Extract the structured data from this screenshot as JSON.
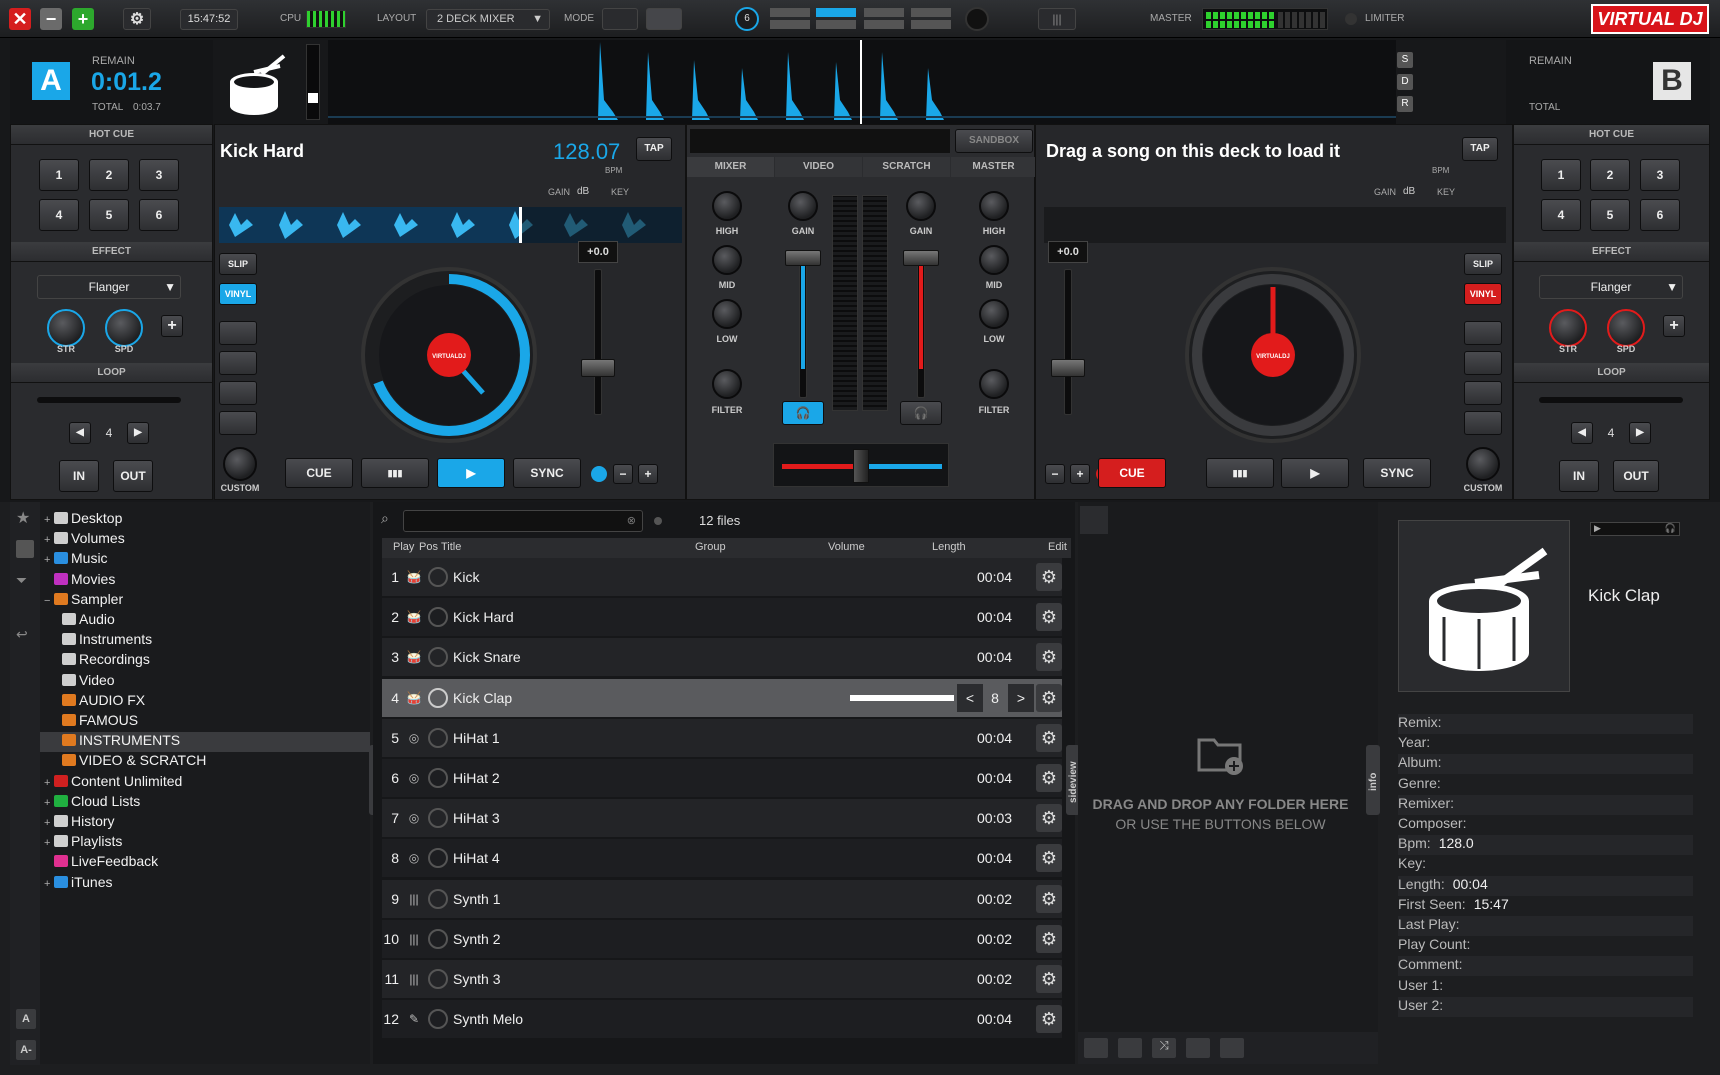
{
  "topbar": {
    "time": "15:47:52",
    "cpu_label": "CPU",
    "layout_label": "LAYOUT",
    "layout_value": "2 DECK MIXER",
    "mode_label": "MODE",
    "decks_count": "6",
    "master_label": "MASTER",
    "limiter_label": "LIMITER",
    "logo": "VIRTUAL DJ",
    "colors": {
      "close": "#e02020",
      "minimize": "#666666",
      "maximize": "#2fb52f",
      "accent": "#1aa7e8",
      "logo": "#d8141a"
    }
  },
  "deck_a": {
    "letter": "A",
    "remain_label": "REMAIN",
    "remain": "0:01.2",
    "total_label": "TOTAL",
    "total": "0:03.7",
    "title": "Kick Hard",
    "bpm": "128.07",
    "bpm_label": "BPM",
    "tap": "TAP",
    "gain_label": "GAIN",
    "db_label": "dB",
    "key_label": "KEY",
    "pitch": "+0.0",
    "slip": "SLIP",
    "vinyl": "VINYL",
    "custom": "CUSTOM",
    "cue": "CUE",
    "pause": "▮▮▮",
    "play": "▶",
    "sync": "SYNC",
    "minus": "−",
    "plus": "+"
  },
  "deck_b": {
    "letter": "B",
    "remain_label": "REMAIN",
    "total_label": "TOTAL",
    "title": "Drag a song on this deck to load it",
    "bpm_label": "BPM",
    "tap": "TAP",
    "gain_label": "GAIN",
    "db_label": "dB",
    "key_label": "KEY",
    "pitch": "+0.0",
    "slip": "SLIP",
    "vinyl": "VINYL",
    "custom": "CUSTOM",
    "cue": "CUE",
    "pause": "▮▮▮",
    "play": "▶",
    "sync": "SYNC",
    "minus": "−",
    "plus": "+"
  },
  "left_side": {
    "hotcue_label": "HOT CUE",
    "hotcues": [
      "1",
      "2",
      "3",
      "4",
      "5",
      "6"
    ],
    "effect_label": "EFFECT",
    "effect_value": "Flanger",
    "str": "STR",
    "spd": "SPD",
    "add": "+",
    "loop_label": "LOOP",
    "loop_value": "4",
    "loop_prev": "◀",
    "loop_next": "▶",
    "in": "IN",
    "out": "OUT"
  },
  "right_side": {
    "hotcue_label": "HOT CUE",
    "hotcues": [
      "1",
      "2",
      "3",
      "4",
      "5",
      "6"
    ],
    "effect_label": "EFFECT",
    "effect_value": "Flanger",
    "str": "STR",
    "spd": "SPD",
    "add": "+",
    "loop_label": "LOOP",
    "loop_value": "4",
    "loop_prev": "◀",
    "loop_next": "▶",
    "in": "IN",
    "out": "OUT"
  },
  "mixer": {
    "sandbox": "SANDBOX",
    "tabs": [
      "MIXER",
      "VIDEO",
      "SCRATCH",
      "MASTER"
    ],
    "high": "HIGH",
    "mid": "MID",
    "low": "LOW",
    "filter": "FILTER",
    "gain": "GAIN"
  },
  "deck_side": {
    "s": "S",
    "d": "D",
    "r": "R"
  },
  "browser": {
    "files_count": "12 files",
    "search_placeholder": "",
    "columns": [
      "Play",
      "Pos",
      "Title",
      "Group",
      "Volume",
      "Length",
      "Edit"
    ],
    "folders_tab": "folders",
    "sideview_tab": "sideview",
    "info_tab": "info",
    "selected_value": "8",
    "rows": [
      {
        "n": "1",
        "title": "Kick",
        "length": "00:04"
      },
      {
        "n": "2",
        "title": "Kick Hard",
        "length": "00:04"
      },
      {
        "n": "3",
        "title": "Kick Snare",
        "length": "00:04"
      },
      {
        "n": "4",
        "title": "Kick Clap",
        "length": ""
      },
      {
        "n": "5",
        "title": "HiHat 1",
        "length": "00:04"
      },
      {
        "n": "6",
        "title": "HiHat 2",
        "length": "00:04"
      },
      {
        "n": "7",
        "title": "HiHat 3",
        "length": "00:03"
      },
      {
        "n": "8",
        "title": "HiHat 4",
        "length": "00:04"
      },
      {
        "n": "9",
        "title": "Synth 1",
        "length": "00:02"
      },
      {
        "n": "10",
        "title": "Synth 2",
        "length": "00:02"
      },
      {
        "n": "11",
        "title": "Synth 3",
        "length": "00:02"
      },
      {
        "n": "12",
        "title": "Synth Melo",
        "length": "00:04"
      }
    ]
  },
  "tree": [
    {
      "label": "Desktop",
      "icon": "desktop-icon",
      "color": "#cfcfcf"
    },
    {
      "label": "Volumes",
      "icon": "volumes-icon",
      "color": "#cfcfcf"
    },
    {
      "label": "Music",
      "icon": "music-icon",
      "color": "#2a8fe0"
    },
    {
      "label": "Movies",
      "icon": "movies-icon",
      "color": "#c030c0"
    },
    {
      "label": "Sampler",
      "icon": "sampler-icon",
      "color": "#e07a20"
    },
    {
      "label": "Audio",
      "icon": "folder-icon",
      "color": "#cfcfcf"
    },
    {
      "label": "Instruments",
      "icon": "folder-icon",
      "color": "#cfcfcf"
    },
    {
      "label": "Recordings",
      "icon": "tape-icon",
      "color": "#cfcfcf"
    },
    {
      "label": "Video",
      "icon": "folder-icon",
      "color": "#cfcfcf"
    },
    {
      "label": "AUDIO FX",
      "icon": "sampler-icon",
      "color": "#e07a20"
    },
    {
      "label": "FAMOUS",
      "icon": "sampler-icon",
      "color": "#e07a20"
    },
    {
      "label": "INSTRUMENTS",
      "icon": "sampler-icon",
      "color": "#e07a20"
    },
    {
      "label": "VIDEO & SCRATCH",
      "icon": "sampler-icon",
      "color": "#e07a20"
    },
    {
      "label": "Content Unlimited",
      "icon": "content-icon",
      "color": "#d02020"
    },
    {
      "label": "Cloud Lists",
      "icon": "cloud-icon",
      "color": "#20b040"
    },
    {
      "label": "History",
      "icon": "history-icon",
      "color": "#cfcfcf"
    },
    {
      "label": "Playlists",
      "icon": "playlist-icon",
      "color": "#cfcfcf"
    },
    {
      "label": "LiveFeedback",
      "icon": "livefeedback-icon",
      "color": "#e03090"
    },
    {
      "label": "iTunes",
      "icon": "itunes-icon",
      "color": "#2a8fe0"
    }
  ],
  "sideview": {
    "drop_line1": "DRAG AND DROP ANY FOLDER HERE",
    "drop_line2": "OR USE THE BUTTONS BELOW"
  },
  "info": {
    "title": "Kick Clap",
    "fields": [
      {
        "label": "Remix:",
        "value": ""
      },
      {
        "label": "Year:",
        "value": ""
      },
      {
        "label": "Album:",
        "value": ""
      },
      {
        "label": "Genre:",
        "value": ""
      },
      {
        "label": "Remixer:",
        "value": ""
      },
      {
        "label": "Composer:",
        "value": ""
      },
      {
        "label": "Bpm:",
        "value": "128.0"
      },
      {
        "label": "Key:",
        "value": ""
      },
      {
        "label": "Length:",
        "value": "00:04"
      },
      {
        "label": "First Seen:",
        "value": "15:47"
      },
      {
        "label": "Last Play:",
        "value": ""
      },
      {
        "label": "Play Count:",
        "value": ""
      },
      {
        "label": "Comment:",
        "value": ""
      },
      {
        "label": "User 1:",
        "value": ""
      },
      {
        "label": "User 2:",
        "value": ""
      }
    ]
  }
}
